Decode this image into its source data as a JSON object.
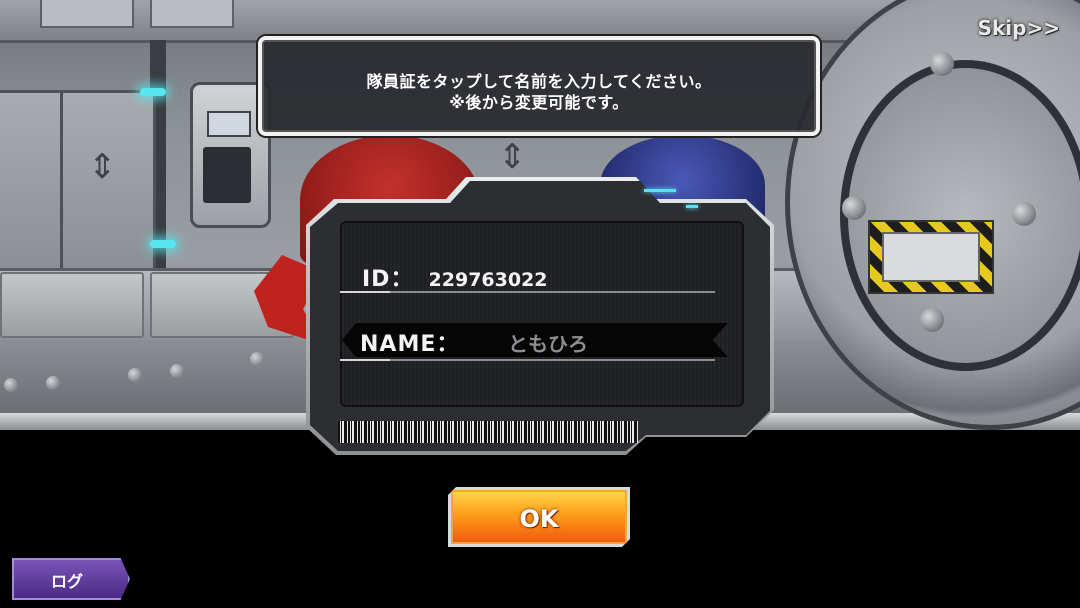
{
  "banner": {
    "line1": "隊員証をタップして名前を入力してください。",
    "line2": "※後から変更可能です。"
  },
  "skip_label": "Skip>>",
  "id_card": {
    "id_label": "ID：",
    "id_value": "229763022",
    "name_label": "NAME：",
    "name_value": "ともひろ"
  },
  "ok_label": "OK",
  "log_label": "ログ",
  "colors": {
    "ok_button_top": "#ffd94a",
    "ok_button_bottom": "#f0560c",
    "log_button": "#4b2a86",
    "accent_cyan": "#58dff2",
    "banner_bg": "#28292e"
  }
}
